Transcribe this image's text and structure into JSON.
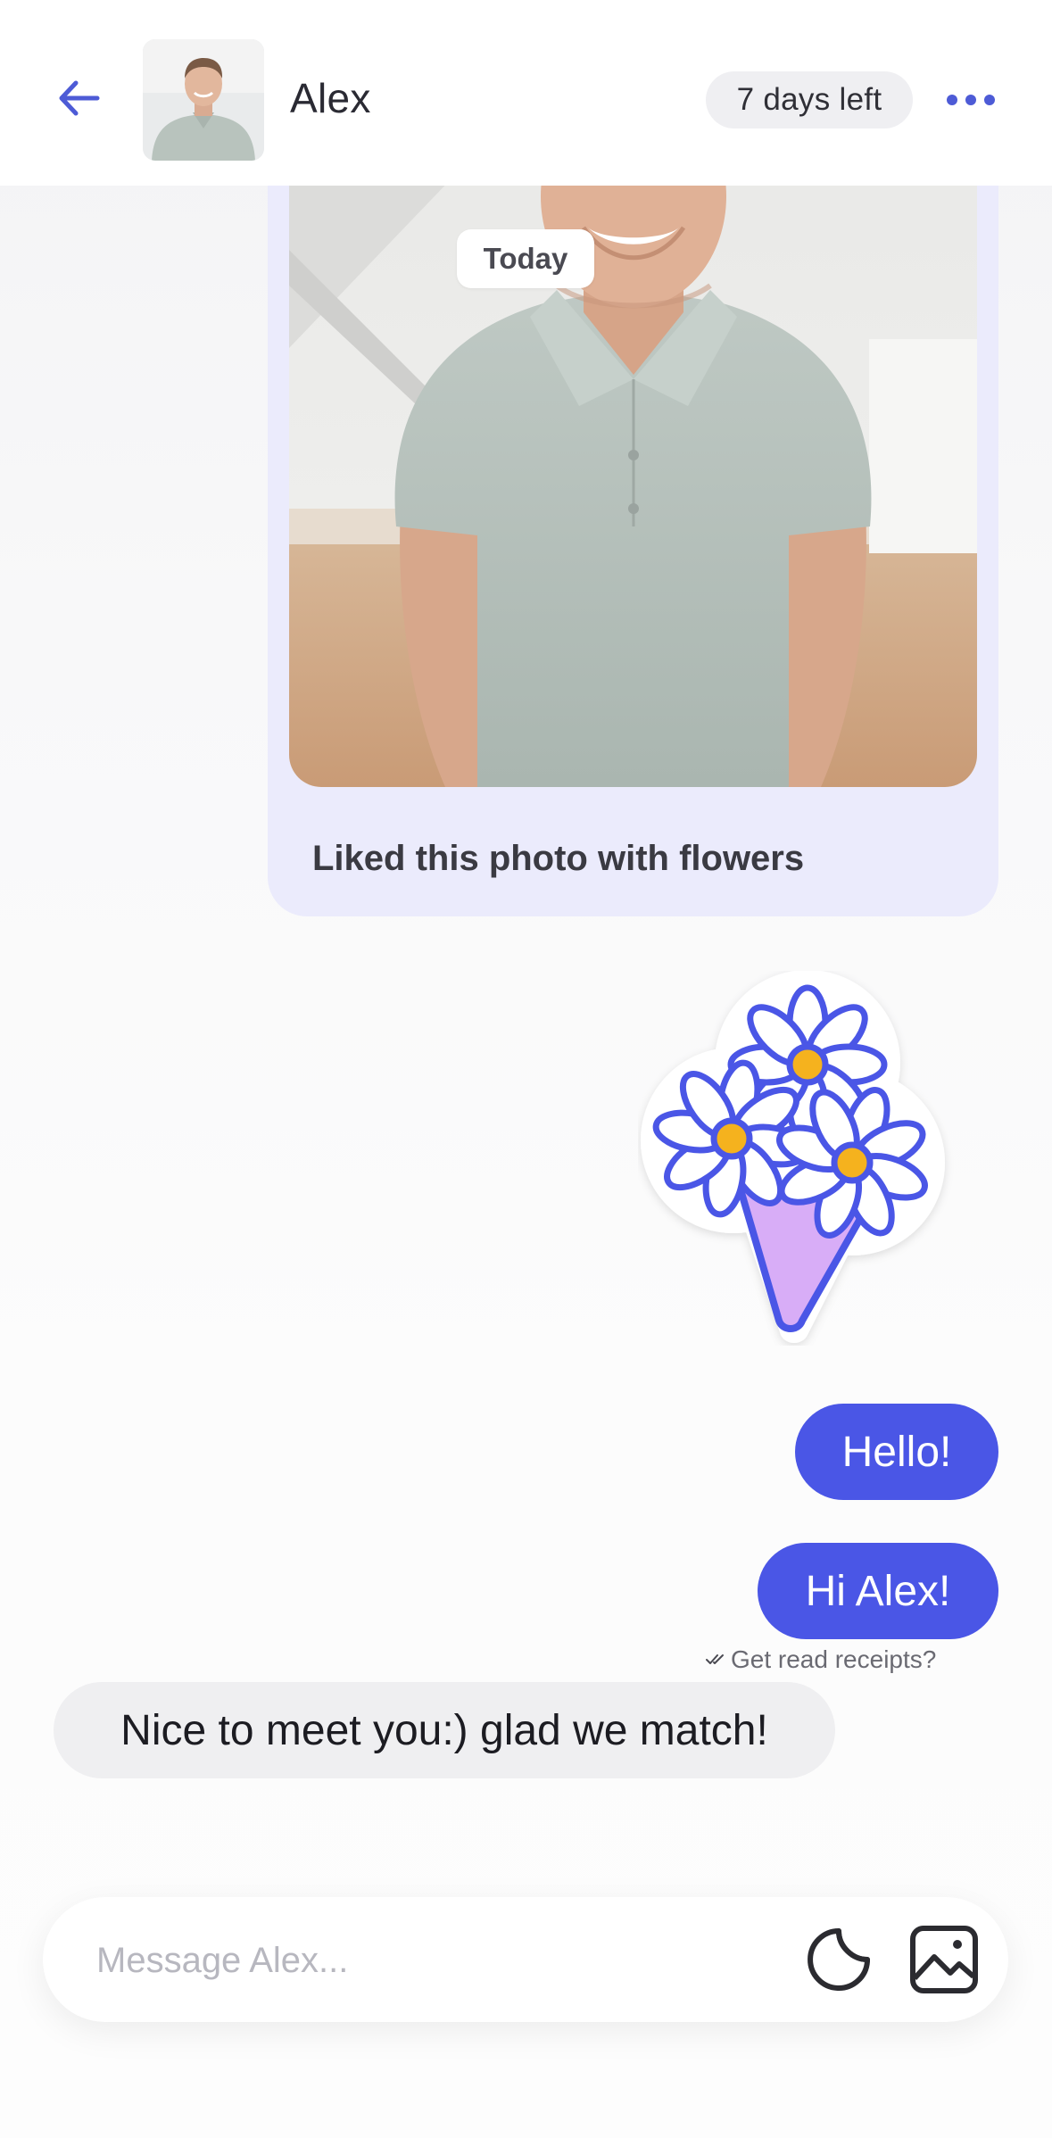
{
  "header": {
    "name": "Alex",
    "days_left": "7 days left"
  },
  "chat": {
    "date_divider": "Today",
    "photo_like_caption": "Liked this photo with flowers",
    "messages_out": [
      "Hello!",
      "Hi Alex!"
    ],
    "read_receipt_prompt": "Get read receipts?",
    "message_in": "Nice to meet you:) glad we match!"
  },
  "composer": {
    "placeholder": "Message Alex..."
  },
  "colors": {
    "accent": "#4a56e6",
    "card_background": "#ebebfc",
    "incoming_bubble": "#efeff1"
  },
  "icons": [
    "arrow-left-icon",
    "more-dots-icon",
    "sticker-icon",
    "image-icon",
    "double-check-icon"
  ]
}
